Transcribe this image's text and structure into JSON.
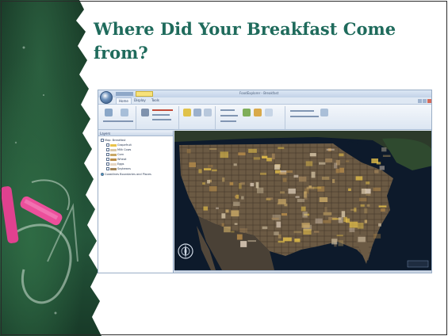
{
  "slide": {
    "title": "Where Did Your Breakfast Come from?"
  },
  "app": {
    "window_title": "FoodExplorer - Breakfast",
    "tabs": [
      "Home",
      "Display",
      "Tools"
    ],
    "layers_panel_title": "Layers",
    "layers": [
      "Map: Breakfast",
      "Grapefruit",
      "Milk Cows",
      "Corn",
      "Wheat",
      "Eggs",
      "Soybeans",
      "Coastlines Boundaries and Places"
    ],
    "layer_colors": [
      "#ffffff",
      "#e9c34a",
      "#d8c7a8",
      "#c9a866",
      "#b98d4a",
      "#e6d5c2",
      "#a4855a",
      "#3fa0c9"
    ],
    "map_colors": {
      "ocean": "#0d1a2b",
      "land_base": "#6b5a44",
      "canada": "#2c3a2a",
      "mexico": "#4a4136"
    }
  },
  "icons": {
    "app_orb": "app-orb-icon",
    "compass": "compass-icon",
    "chalk": "chalk-icon"
  }
}
